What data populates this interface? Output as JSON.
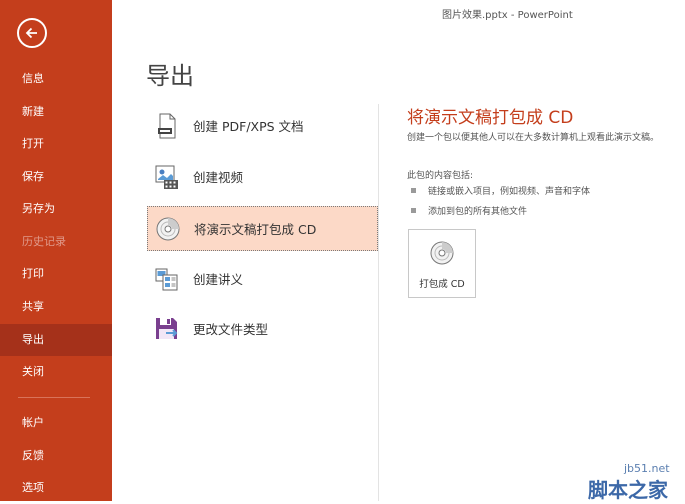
{
  "window": {
    "title": "图片效果.pptx  -  PowerPoint"
  },
  "sidebar": {
    "back_icon": "back-arrow-icon",
    "items": [
      {
        "label": "信息",
        "state": "normal"
      },
      {
        "label": "新建",
        "state": "normal"
      },
      {
        "label": "打开",
        "state": "normal"
      },
      {
        "label": "保存",
        "state": "normal"
      },
      {
        "label": "另存为",
        "state": "normal"
      },
      {
        "label": "历史记录",
        "state": "disabled"
      },
      {
        "label": "打印",
        "state": "normal"
      },
      {
        "label": "共享",
        "state": "normal"
      },
      {
        "label": "导出",
        "state": "active"
      },
      {
        "label": "关闭",
        "state": "normal"
      }
    ],
    "bottom_items": [
      {
        "label": "帐户"
      },
      {
        "label": "反馈"
      },
      {
        "label": "选项"
      }
    ],
    "color": "#c43e1c",
    "active_color": "#a5311a"
  },
  "main": {
    "title": "导出",
    "options": [
      {
        "label": "创建 PDF/XPS 文档",
        "icon": "pdf-document-icon",
        "selected": false
      },
      {
        "label": "创建视频",
        "icon": "video-icon",
        "selected": false
      },
      {
        "label": "将演示文稿打包成 CD",
        "icon": "cd-icon",
        "selected": true
      },
      {
        "label": "创建讲义",
        "icon": "handout-icon",
        "selected": false
      },
      {
        "label": "更改文件类型",
        "icon": "change-file-type-icon",
        "selected": false
      }
    ]
  },
  "panel": {
    "title": "将演示文稿打包成 CD",
    "description": "创建一个包以便其他人可以在大多数计算机上观看此演示文稿。",
    "subheading": "此包的内容包括:",
    "bullets": [
      "链接或嵌入项目，例如视频、声音和字体",
      "添加到包的所有其他文件"
    ],
    "button_label": "打包成 CD",
    "button_icon": "cd-disc-icon",
    "accent_color": "#c43e1c"
  },
  "watermark": {
    "small": "jb51.net",
    "big": "脚本之家"
  }
}
